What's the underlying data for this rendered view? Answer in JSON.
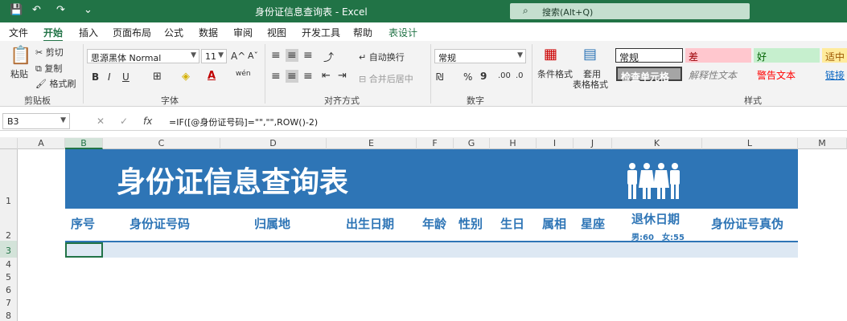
{
  "window": {
    "title": "身份证信息查询表 - Excel",
    "search_icon": "search-icon",
    "search_text": "搜索(Alt+Q)",
    "qa_save": "💾",
    "qa_undo": "↶",
    "qa_redo": "↷",
    "qa_more": "⌄"
  },
  "menu": [
    "文件",
    "开始",
    "插入",
    "页面布局",
    "公式",
    "数据",
    "审阅",
    "视图",
    "开发工具",
    "帮助",
    "表设计"
  ],
  "ribbon": {
    "paste": "粘贴",
    "cut": "剪切",
    "copy": "复制",
    "format_painter": "格式刷",
    "clipboard": "剪贴板",
    "font_name": "思源黑体 Normal",
    "font_size": "11",
    "grow": "A^",
    "shrink": "Aˇ",
    "bold": "B",
    "italic": "I",
    "underline": "U",
    "wen": "wén",
    "font_group": "字体",
    "wrap": "自动换行",
    "merge": "合并后居中",
    "align_group": "对齐方式",
    "number_format": "常规",
    "pct": "%",
    "comma": "9",
    "number_group": "数字",
    "cond_format": "条件格式",
    "table_format_1": "套用",
    "table_format_2": "表格格式",
    "style_normal": "常规",
    "style_bad": "差",
    "style_good": "好",
    "style_neutral": "适中",
    "style_check": "检查单元格",
    "style_explain": "解释性文本",
    "style_warn": "警告文本",
    "style_link": "链接",
    "styles_group": "样式"
  },
  "formula_bar": {
    "name_box": "B3",
    "cancel": "✕",
    "enter": "✓",
    "fx": "fx",
    "formula": "=IF([@身份证号码]=\"\",\"\",ROW()-2)"
  },
  "columns": [
    "A",
    "B",
    "C",
    "D",
    "E",
    "F",
    "G",
    "H",
    "I",
    "J",
    "K",
    "L",
    "M"
  ],
  "rows": [
    "1",
    "2",
    "3",
    "4",
    "5",
    "6",
    "7",
    "8"
  ],
  "sheet": {
    "banner_title": "身份证信息查询表",
    "people_icon": "people-icon",
    "headers": [
      "序号",
      "身份证号码",
      "归属地",
      "出生日期",
      "年龄",
      "性别",
      "生日",
      "属相",
      "星座",
      "退休日期",
      "身份证号真伪"
    ],
    "retire_note_male": "男:60",
    "retire_note_female": "女:55",
    "banner_color": "#2e75b6",
    "header_color": "#2e75b6"
  }
}
